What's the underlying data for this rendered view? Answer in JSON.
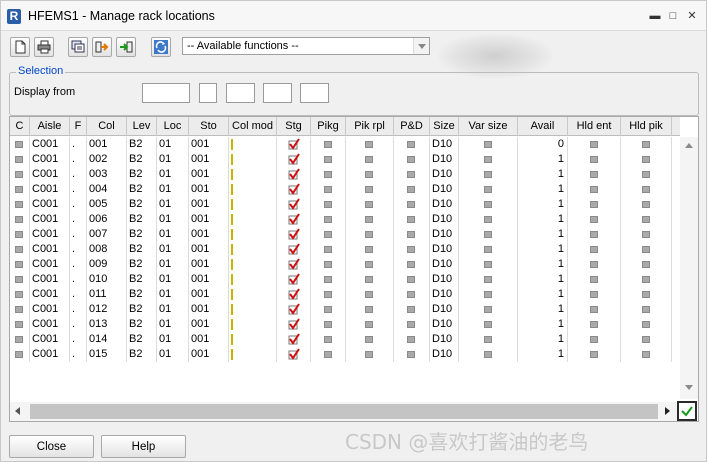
{
  "window": {
    "title": "HFEMS1 - Manage rack locations",
    "logo_letter": "R",
    "minimize_glyph": "▬",
    "maximize_glyph": "□",
    "close_glyph": "✕"
  },
  "toolbar": {
    "buttons": [
      {
        "name": "new-document-icon"
      },
      {
        "name": "print-icon"
      },
      {
        "name": "copy-records-icon"
      },
      {
        "name": "export-arrow-icon"
      },
      {
        "name": "import-arrow-icon"
      },
      {
        "name": "refresh-icon"
      }
    ],
    "functions_select": "-- Available functions --"
  },
  "selection": {
    "legend": "Selection",
    "display_from_label": "Display from"
  },
  "grid": {
    "columns": [
      "C",
      "Aisle",
      "F",
      "Col",
      "Lev",
      "Loc",
      "Sto",
      "Col mod",
      "Stg",
      "Pikg",
      "Pik rpl",
      "P&D",
      "Size",
      "Var size",
      "Avail",
      "Hld ent",
      "Hld pik"
    ],
    "rows": [
      {
        "aisle": "C001",
        "f": ".",
        "col": "001",
        "lev": "B2",
        "loc": "01",
        "sto": "001",
        "size": "D10",
        "avail": "0"
      },
      {
        "aisle": "C001",
        "f": ".",
        "col": "002",
        "lev": "B2",
        "loc": "01",
        "sto": "001",
        "size": "D10",
        "avail": "1"
      },
      {
        "aisle": "C001",
        "f": ".",
        "col": "003",
        "lev": "B2",
        "loc": "01",
        "sto": "001",
        "size": "D10",
        "avail": "1"
      },
      {
        "aisle": "C001",
        "f": ".",
        "col": "004",
        "lev": "B2",
        "loc": "01",
        "sto": "001",
        "size": "D10",
        "avail": "1"
      },
      {
        "aisle": "C001",
        "f": ".",
        "col": "005",
        "lev": "B2",
        "loc": "01",
        "sto": "001",
        "size": "D10",
        "avail": "1"
      },
      {
        "aisle": "C001",
        "f": ".",
        "col": "006",
        "lev": "B2",
        "loc": "01",
        "sto": "001",
        "size": "D10",
        "avail": "1"
      },
      {
        "aisle": "C001",
        "f": ".",
        "col": "007",
        "lev": "B2",
        "loc": "01",
        "sto": "001",
        "size": "D10",
        "avail": "1"
      },
      {
        "aisle": "C001",
        "f": ".",
        "col": "008",
        "lev": "B2",
        "loc": "01",
        "sto": "001",
        "size": "D10",
        "avail": "1"
      },
      {
        "aisle": "C001",
        "f": ".",
        "col": "009",
        "lev": "B2",
        "loc": "01",
        "sto": "001",
        "size": "D10",
        "avail": "1"
      },
      {
        "aisle": "C001",
        "f": ".",
        "col": "010",
        "lev": "B2",
        "loc": "01",
        "sto": "001",
        "size": "D10",
        "avail": "1"
      },
      {
        "aisle": "C001",
        "f": ".",
        "col": "011",
        "lev": "B2",
        "loc": "01",
        "sto": "001",
        "size": "D10",
        "avail": "1"
      },
      {
        "aisle": "C001",
        "f": ".",
        "col": "012",
        "lev": "B2",
        "loc": "01",
        "sto": "001",
        "size": "D10",
        "avail": "1"
      },
      {
        "aisle": "C001",
        "f": ".",
        "col": "013",
        "lev": "B2",
        "loc": "01",
        "sto": "001",
        "size": "D10",
        "avail": "1"
      },
      {
        "aisle": "C001",
        "f": ".",
        "col": "014",
        "lev": "B2",
        "loc": "01",
        "sto": "001",
        "size": "D10",
        "avail": "1"
      },
      {
        "aisle": "C001",
        "f": ".",
        "col": "015",
        "lev": "B2",
        "loc": "01",
        "sto": "001",
        "size": "D10",
        "avail": "1"
      }
    ]
  },
  "footer": {
    "close_label": "Close",
    "help_label": "Help"
  },
  "watermark": "CSDN @喜欢打酱油的老鸟",
  "colors": {
    "selection_legend": "#0047c8",
    "stage_mark": "#d01010",
    "ok_check": "#1a9a1a"
  }
}
